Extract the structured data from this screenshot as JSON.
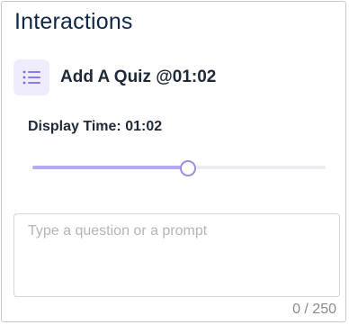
{
  "panel": {
    "title": "Interactions"
  },
  "interaction": {
    "icon": "list-icon",
    "label": "Add A Quiz @01:02",
    "display_time_label": "Display Time: 01:02",
    "slider_position": 0.53
  },
  "prompt": {
    "value": "",
    "placeholder": "Type a question or a prompt",
    "char_count": "0 / 250"
  },
  "colors": {
    "accent": "#9a8ee3",
    "accent_fill": "#b6abee",
    "icon_bg": "#efecfd",
    "title": "#0f2744"
  }
}
